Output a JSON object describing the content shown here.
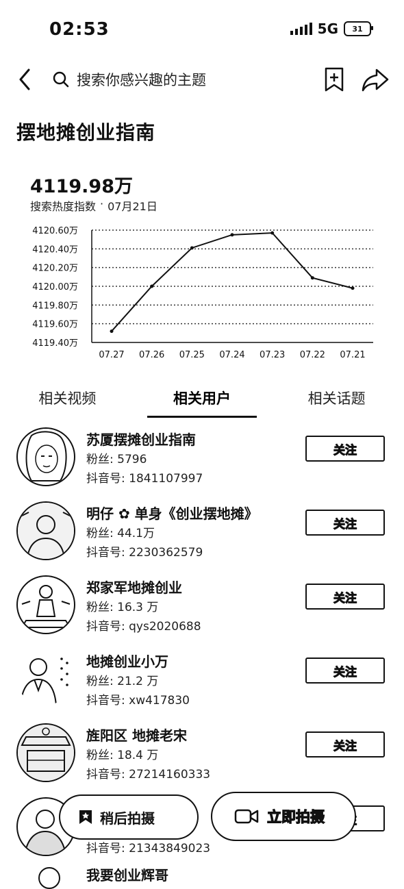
{
  "status": {
    "time": "02:53",
    "network": "5G",
    "battery": "31"
  },
  "nav": {
    "search_placeholder": "搜索你感兴趣的主题"
  },
  "page": {
    "title": "摆地摊创业指南",
    "value": "4119.98万",
    "index_label": "搜索热度指数",
    "dot": "·",
    "date": "07月21日"
  },
  "chart_data": {
    "type": "line",
    "x": [
      "07.27",
      "07.26",
      "07.25",
      "07.24",
      "07.23",
      "07.22",
      "07.21"
    ],
    "y_ticks": [
      "4120.60万",
      "4120.40万",
      "4120.20万",
      "4120.00万",
      "4119.80万",
      "4119.60万",
      "4119.40万"
    ],
    "ylim": [
      4119.4,
      4120.6
    ],
    "values": [
      4119.52,
      4120.0,
      4120.41,
      4120.55,
      4120.57,
      4120.09,
      4119.98
    ],
    "grid": "horizontal dashed"
  },
  "tabs": [
    {
      "label": "相关视频"
    },
    {
      "label": "相关用户"
    },
    {
      "label": "相关话题"
    }
  ],
  "users": [
    {
      "name": "苏厦摆摊创业指南",
      "fans": "粉丝: 5796",
      "douyin_id": "抖音号: 1841107997",
      "follow": "关注"
    },
    {
      "name": "明仔 ✿ 单身《创业摆地摊》",
      "fans": "粉丝: 44.1万",
      "douyin_id": "抖音号: 2230362579",
      "follow": "关注"
    },
    {
      "name": "郑家军地摊创业",
      "fans": "粉丝: 16.3 万",
      "douyin_id": "抖音号: qys2020688",
      "follow": "关注"
    },
    {
      "name": "地摊创业小万",
      "fans": "粉丝: 21.2 万",
      "douyin_id": "抖音号: xw417830",
      "follow": "关注"
    },
    {
      "name": "旌阳区 地摊老宋",
      "fans": "粉丝: 18.4 万",
      "douyin_id": "抖音号: 27214160333",
      "follow": "关注"
    },
    {
      "name": "",
      "fans": "",
      "douyin_id": "抖音号: 21343849023",
      "follow": "关注"
    }
  ],
  "partial_row": "我要创业辉哥",
  "actions": {
    "later": "稍后拍摄",
    "shoot_now": "立即拍摄"
  }
}
